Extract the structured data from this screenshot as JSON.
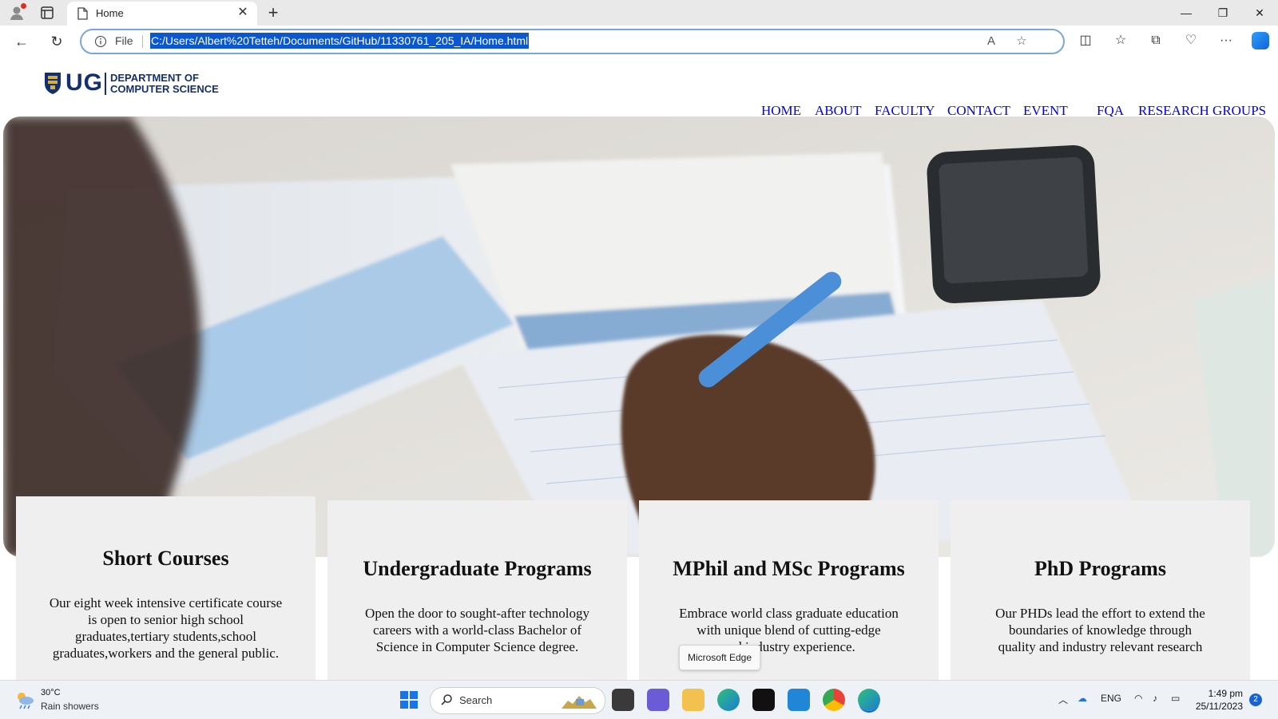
{
  "browser": {
    "tab_title": "Home",
    "address": {
      "scheme_label": "File",
      "url": "C:/Users/Albert%20Tetteh/Documents/GitHub/11330761_205_IA/Home.html"
    }
  },
  "site": {
    "logo_text": "UG",
    "dept_line1": "DEPARTMENT OF",
    "dept_line2": "COMPUTER SCIENCE",
    "nav": [
      "HOME",
      "ABOUT",
      "FACULTY",
      "CONTACT",
      "EVENT",
      "FQA",
      "RESEARCH GROUPS"
    ]
  },
  "cards": [
    {
      "title": "Short Courses",
      "lines": [
        "Our eight week intensive certificate course",
        "is open to senior high school",
        "graduates,tertiary students,school",
        "graduates,workers and the general public."
      ]
    },
    {
      "title": "Undergraduate Programs",
      "lines": [
        "Open the door to sought-after technology",
        "careers with a world-class Bachelor of",
        "Science in Computer Science degree."
      ]
    },
    {
      "title": "MPhil and MSc Programs",
      "lines": [
        "Embrace world class graduate education",
        "with unique blend of cutting-edge",
        "and industry experience."
      ]
    },
    {
      "title": "PhD Programs",
      "lines": [
        "Our PHDs lead the effort to extend the",
        "boundaries of knowledge through",
        "quality and industry relevant research"
      ]
    }
  ],
  "tooltip": "Microsoft Edge",
  "taskbar": {
    "weather_temp": "30°C",
    "weather_cond": "Rain showers",
    "search_label": "Search",
    "lang": "ENG",
    "time": "1:49 pm",
    "date": "25/11/2023",
    "notifications": "2"
  },
  "colors": {
    "link": "#0000ee",
    "brand_navy": "#13306c",
    "url_highlight": "#0b57d0",
    "card_bg": "#efefef"
  },
  "icons": [
    "profile-icon",
    "tab-actions-icon",
    "page-icon",
    "close-icon",
    "plus-icon",
    "minimize-icon",
    "restore-icon",
    "back-icon",
    "refresh-icon",
    "info-icon",
    "read-aloud-icon",
    "favorite-star-icon",
    "split-screen-icon",
    "favorites-icon",
    "collections-icon",
    "extensions-icon",
    "more-icon",
    "copilot-icon",
    "weather-icon",
    "windows-start-icon",
    "search-icon",
    "chevron-up-icon",
    "onedrive-icon",
    "wifi-icon",
    "volume-icon",
    "battery-icon"
  ]
}
